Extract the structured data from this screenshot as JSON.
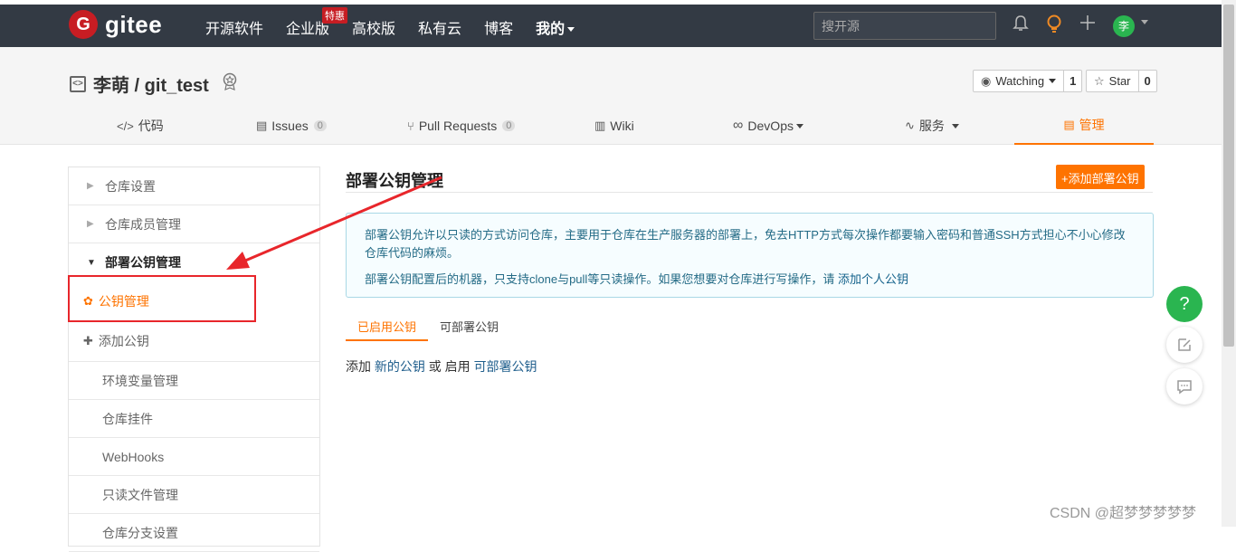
{
  "topbar": {
    "brand": "gitee",
    "brand_mark": "G",
    "nav": [
      {
        "label": "开源软件"
      },
      {
        "label": "企业版",
        "badge": "特惠"
      },
      {
        "label": "高校版"
      },
      {
        "label": "私有云"
      },
      {
        "label": "博客"
      },
      {
        "label": "我的"
      }
    ],
    "search_placeholder": "搜开源",
    "avatar_text": "李"
  },
  "repo": {
    "title": "李萌 / git_test",
    "watch_label": "Watching",
    "watch_count": "1",
    "star_label": "Star",
    "star_count": "0"
  },
  "tabs": [
    {
      "label": "代码"
    },
    {
      "label": "Issues",
      "count": "0"
    },
    {
      "label": "Pull Requests",
      "count": "0"
    },
    {
      "label": "Wiki"
    },
    {
      "label": "DevOps"
    },
    {
      "label": "服务"
    },
    {
      "label": "管理"
    }
  ],
  "sidebar": {
    "items": [
      {
        "label": "仓库设置"
      },
      {
        "label": "仓库成员管理"
      },
      {
        "label": "部署公钥管理"
      },
      {
        "label": "公钥管理"
      },
      {
        "label": "添加公钥"
      },
      {
        "label": "环境变量管理"
      },
      {
        "label": "仓库挂件"
      },
      {
        "label": "WebHooks"
      },
      {
        "label": "只读文件管理"
      },
      {
        "label": "仓库分支设置"
      }
    ]
  },
  "main": {
    "title": "部署公钥管理",
    "add_button": "+添加部署公钥",
    "info_line1": "部署公钥允许以只读的方式访问仓库，主要用于仓库在生产服务器的部署上，免去HTTP方式每次操作都要输入密码和普通SSH方式担心不小心修改仓库代码的麻烦。",
    "info_line2_prefix": "部署公钥配置后的机器，只支持clone与pull等只读操作。如果您想要对仓库进行写操作，请",
    "info_line2_link": "添加个人公钥",
    "subtabs": [
      {
        "label": "已启用公钥"
      },
      {
        "label": "可部署公钥"
      }
    ],
    "empty_prefix": "添加",
    "empty_link1": "新的公钥",
    "empty_mid": "或 启用",
    "empty_link2": "可部署公钥"
  },
  "float": {
    "help": "?"
  },
  "watermark": "CSDN @超梦梦梦梦梦",
  "colors": {
    "accent": "#fe7300",
    "topbar": "#333a44",
    "brand_red": "#c71d23",
    "annotation_red": "#e8262b"
  }
}
